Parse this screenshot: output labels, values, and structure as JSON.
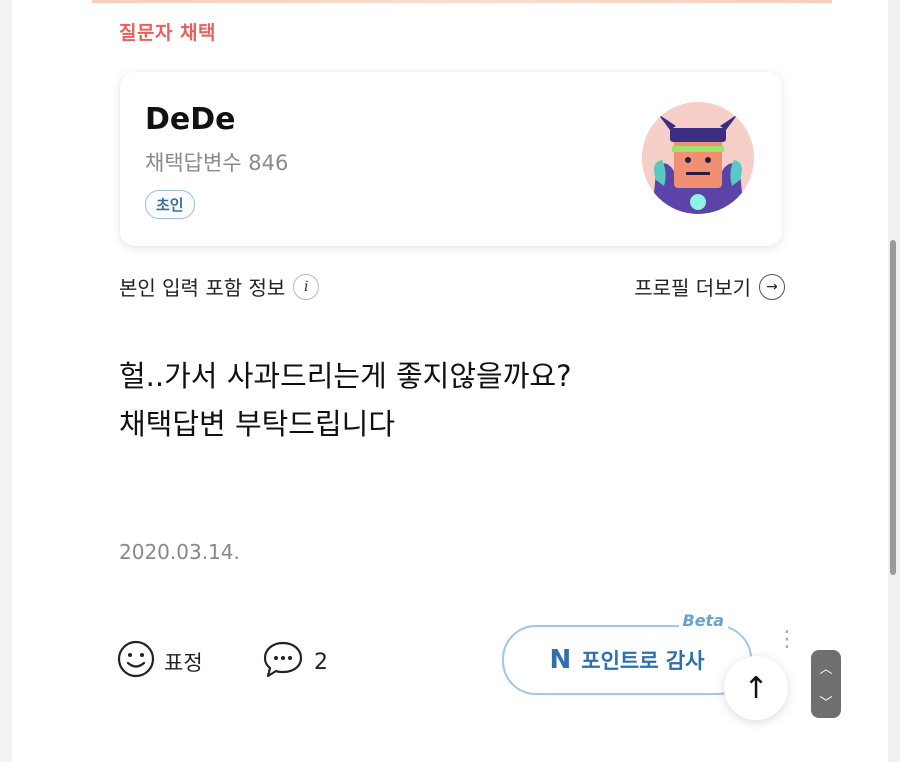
{
  "section": {
    "label": "질문자 채택"
  },
  "profile": {
    "username": "DeDe",
    "adopted_count": "채택답변수 846",
    "rank_badge": "초인",
    "avatar": "robot-avatar-icon"
  },
  "info_row": {
    "input_info_label": "본인 입력 포함 정보",
    "info_icon": "i",
    "more_profile_label": "프로필 더보기",
    "arrow_icon": "→"
  },
  "comment": {
    "lines": [
      "헐..가서 사과드리는게 좋지않을까요?",
      "채택답변 부탁드립니다"
    ],
    "date": "2020.03.14."
  },
  "actions": {
    "emoji_label": "표정",
    "comment_count": "2",
    "point_button_label": "포인트로 감사",
    "point_icon": "N",
    "beta_label": "Beta",
    "scroll_top_icon": "↑"
  },
  "colors": {
    "accent": "#e9605a",
    "point_blue": "#2f6fb0",
    "badge_border": "#9fc0d6"
  }
}
